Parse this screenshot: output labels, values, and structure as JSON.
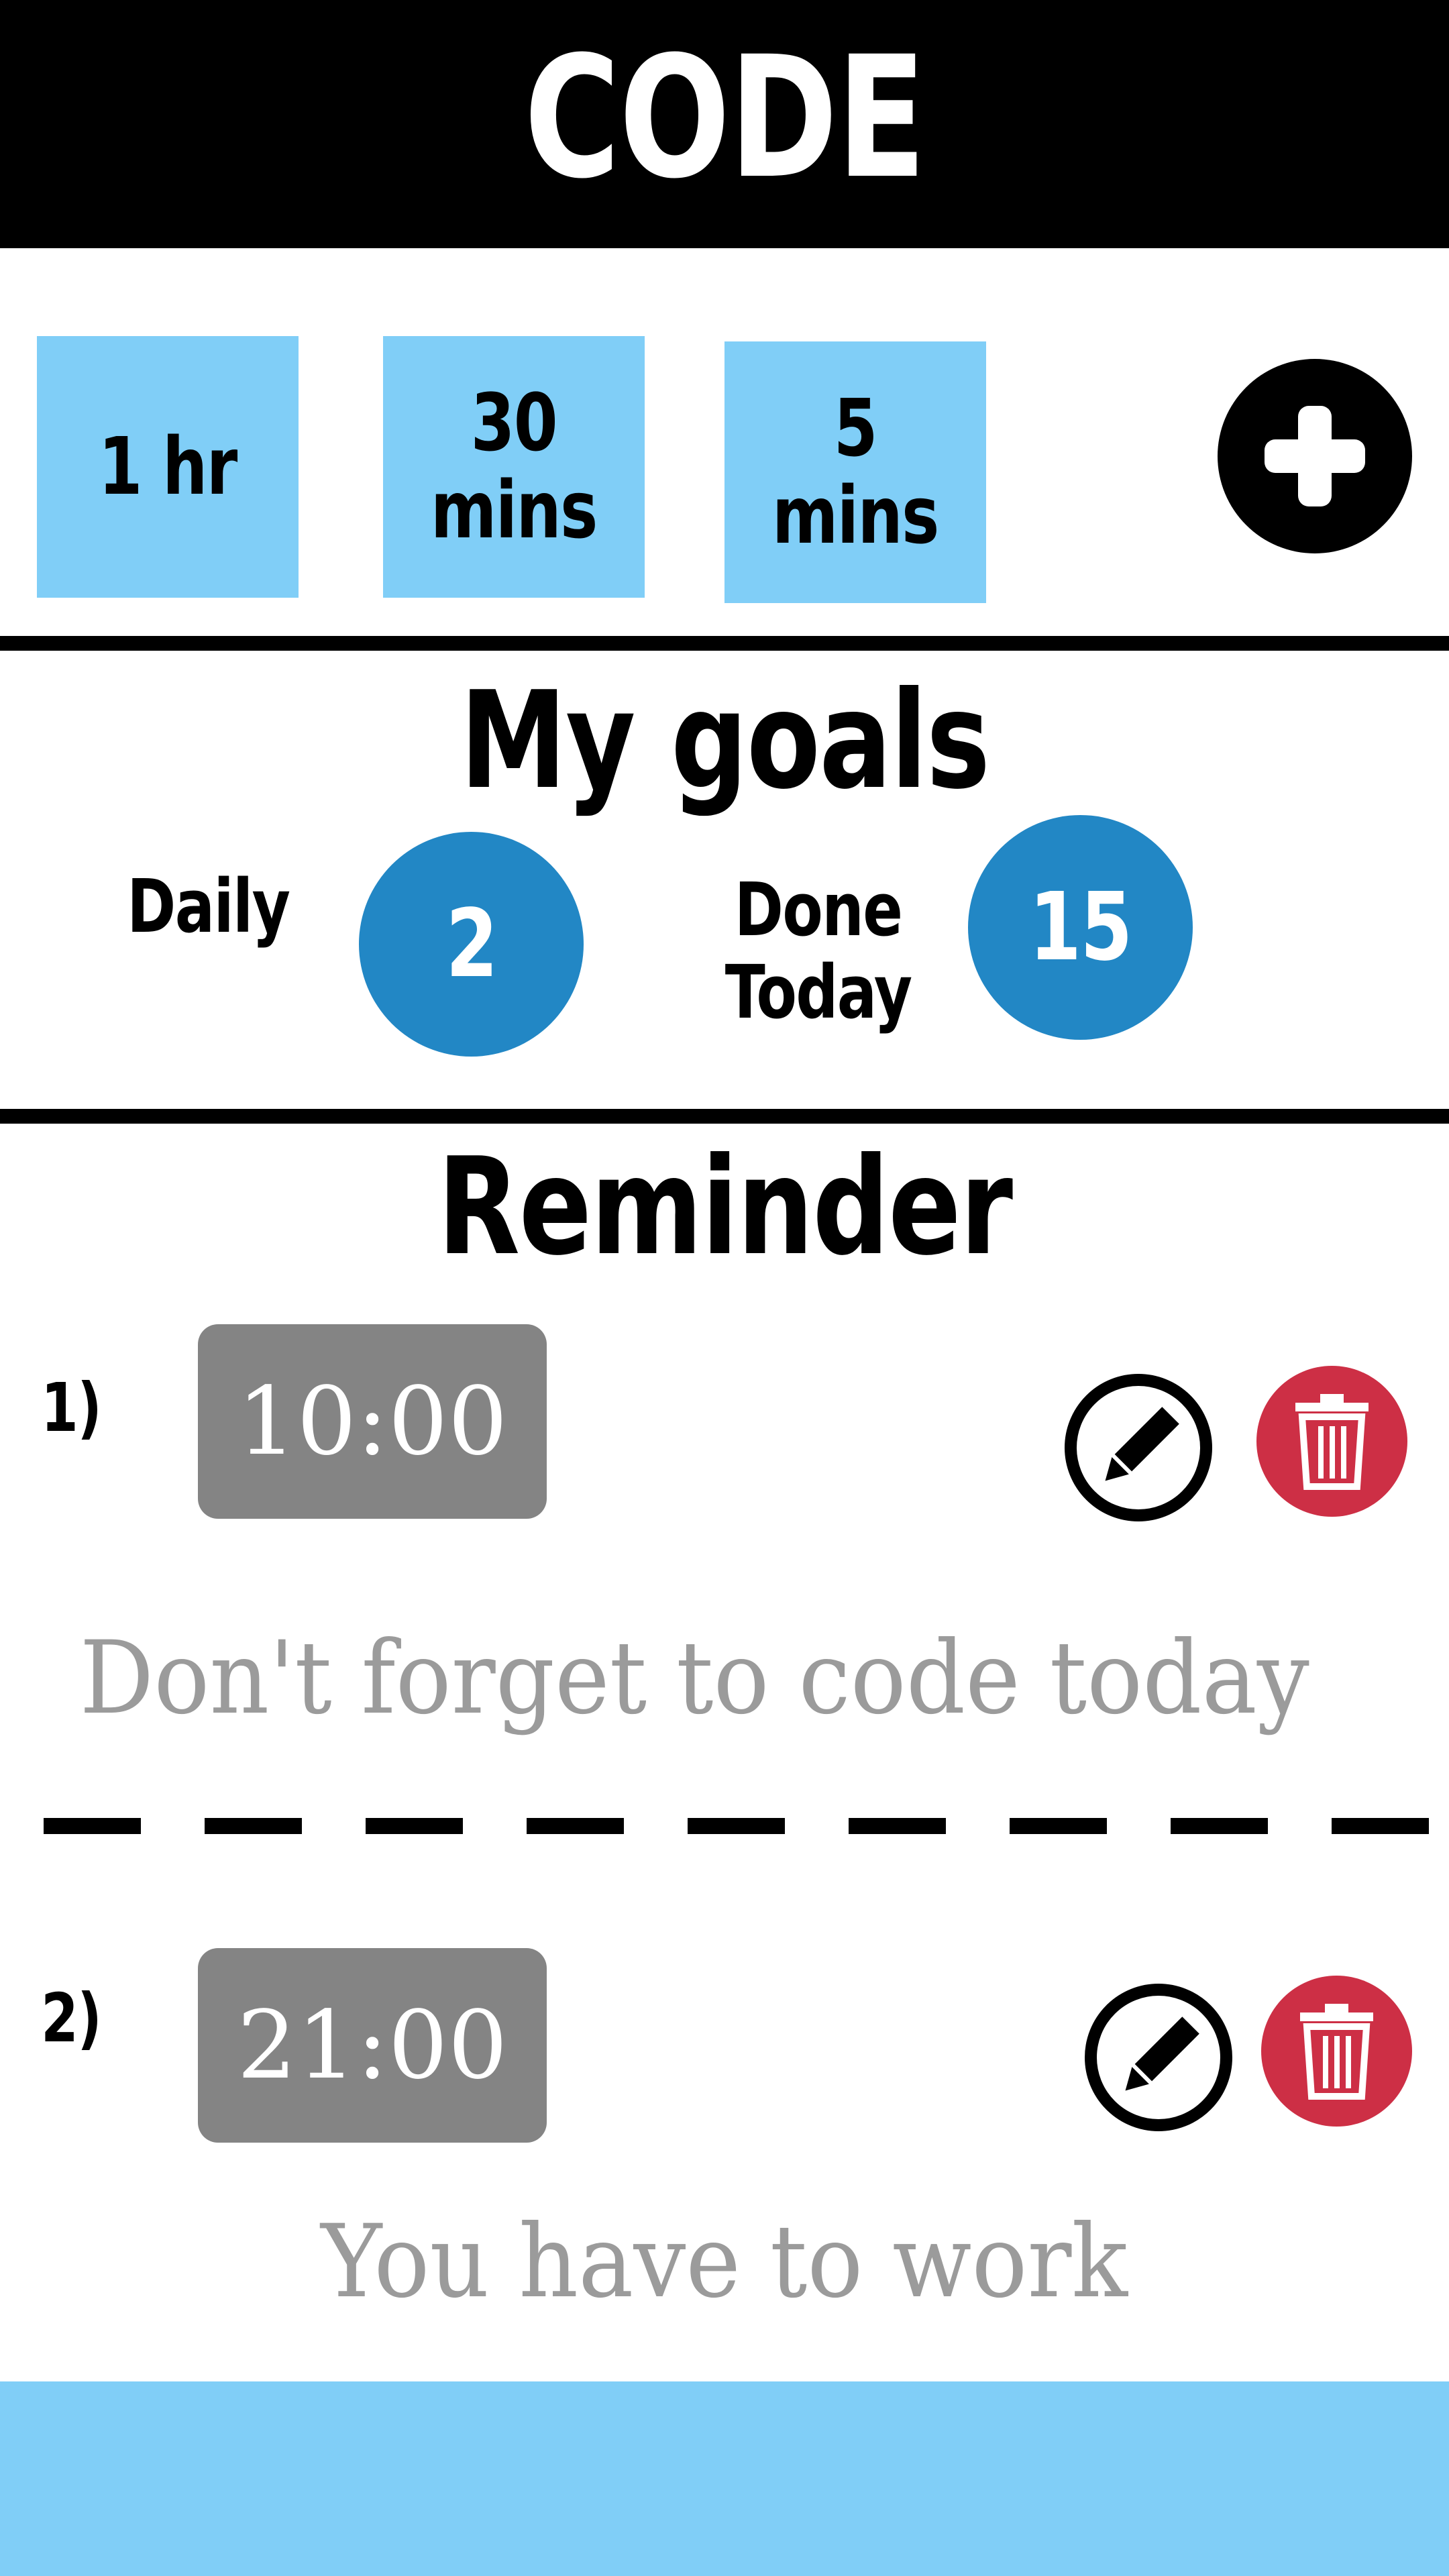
{
  "header": {
    "title": "CODE"
  },
  "presets": [
    {
      "label": "1 hr"
    },
    {
      "label": "30\nmins"
    },
    {
      "label": "5\nmins"
    }
  ],
  "add_button": {
    "icon": "plus-icon"
  },
  "goals": {
    "title": "My goals",
    "daily_label": "Daily",
    "daily_value": "2",
    "done_label": "Done\nToday",
    "done_value": "15"
  },
  "reminders": {
    "title": "Reminder",
    "items": [
      {
        "number": "1)",
        "time": "10:00",
        "message": "Don't forget to code today"
      },
      {
        "number": "2)",
        "time": "21:00",
        "message": "You have to work"
      }
    ]
  },
  "colors": {
    "header_bg": "#000000",
    "preset_bg": "#80cef7",
    "goal_circle": "#2287c5",
    "time_box": "#848484",
    "delete_red": "#cd2f45",
    "message_gray": "#9b9b9b",
    "bottom_bar": "#80cef7"
  },
  "icons": {
    "edit": "pencil-icon",
    "delete": "trash-icon"
  }
}
